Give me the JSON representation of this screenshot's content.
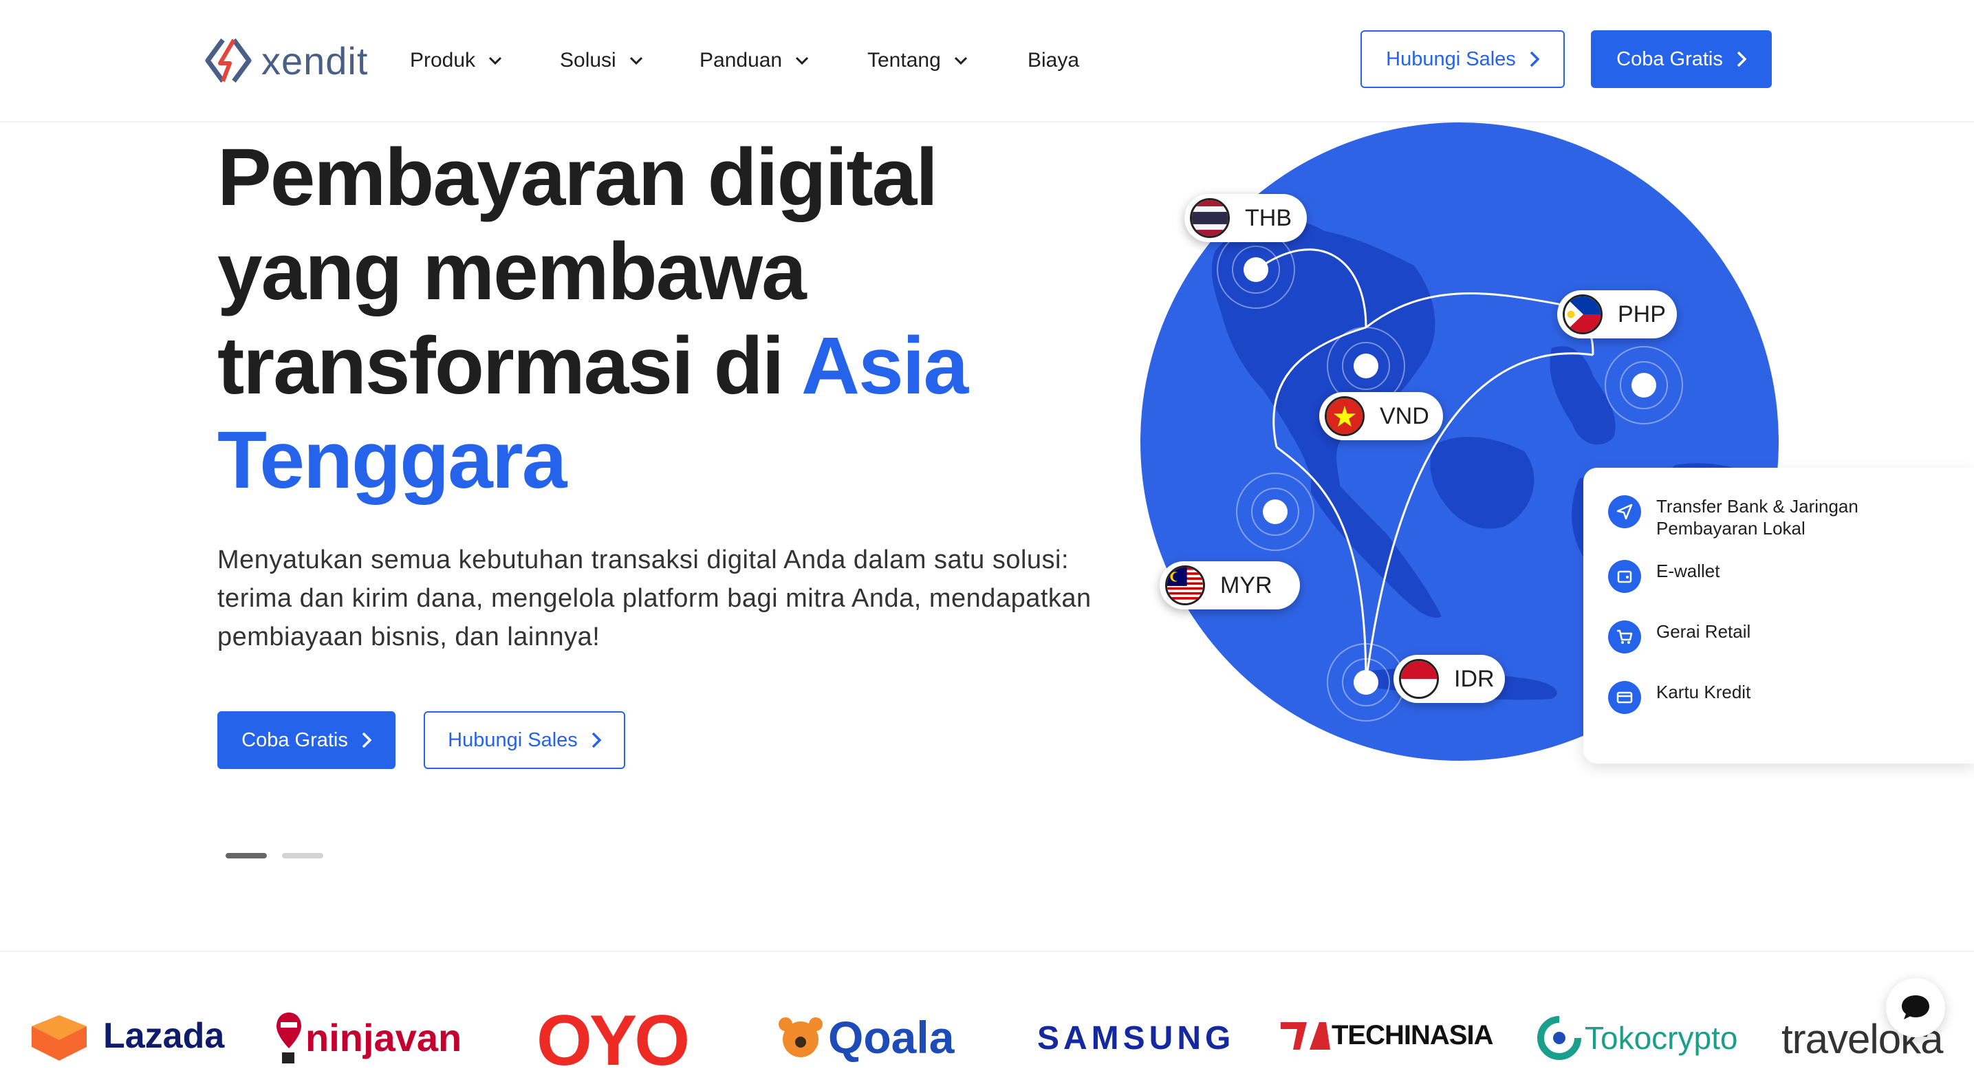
{
  "brand": {
    "name": "xendit",
    "color": "#2563eb"
  },
  "nav": {
    "menu": [
      {
        "label": "Produk",
        "dropdown": true
      },
      {
        "label": "Solusi",
        "dropdown": true
      },
      {
        "label": "Panduan",
        "dropdown": true
      },
      {
        "label": "Tentang",
        "dropdown": true
      },
      {
        "label": "Biaya",
        "dropdown": false
      }
    ],
    "contact_sales": "Hubungi Sales",
    "try_free": "Coba Gratis"
  },
  "hero": {
    "title_line1": "Pembayaran digital",
    "title_line2": "yang membawa",
    "title_line3_plain": "transformasi di ",
    "title_line3_accent": "Asia",
    "title_line4_accent": "Tenggara",
    "description": "Menyatukan semua kebutuhan transaksi digital Anda dalam satu solusi: terima dan kirim dana, mengelola platform bagi mitra Anda, mendapatkan pembiayaan bisnis, dan lainnya!",
    "cta_primary": "Coba Gratis",
    "cta_secondary": "Hubungi Sales",
    "carousel": {
      "total": 2,
      "active": 1
    }
  },
  "currencies": [
    "THB",
    "PHP",
    "VND",
    "MYR",
    "IDR"
  ],
  "payment_methods": [
    {
      "label": "Transfer Bank & Jaringan Pembayaran Lokal",
      "icon": "send-icon"
    },
    {
      "label": "E-wallet",
      "icon": "wallet-icon"
    },
    {
      "label": "Gerai Retail",
      "icon": "cart-icon"
    },
    {
      "label": "Kartu Kredit",
      "icon": "card-icon"
    }
  ],
  "partners": [
    "Lazada",
    "ninjavan",
    "OYO",
    "Qoala",
    "SAMSUNG",
    "TECHINASIA",
    "Tokocrypto",
    "traveloka"
  ],
  "colors": {
    "accent": "#2563eb",
    "map_land": "#1d48c8",
    "text": "#1f1f1f"
  }
}
